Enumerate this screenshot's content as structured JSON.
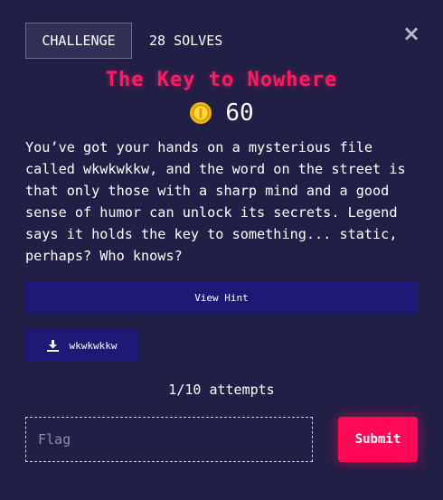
{
  "header": {
    "challenge_tab": "CHALLENGE",
    "solves_tab": "28 SOLVES",
    "close_icon": "×"
  },
  "challenge": {
    "title": "The Key to Nowhere",
    "points": "60",
    "coin_icon": "coin-icon",
    "description": "You’ve got your hands on a mysterious file called wkwkwkkw, and the word on the street is that only those with a sharp mind and a good sense of humor can unlock its secrets. Legend says it holds the key to something... static, perhaps? Who knows?"
  },
  "actions": {
    "hint_label": "View Hint",
    "file_label": "wkwkwkkw",
    "file_icon": "download-icon"
  },
  "attempts": "1/10 attempts",
  "flag_form": {
    "placeholder": "Flag",
    "value": "",
    "submit_label": "Submit"
  },
  "colors": {
    "background": "#211f45",
    "title": "#ff1a63",
    "button_primary": "#1e1877",
    "submit": "#ff0a57"
  }
}
